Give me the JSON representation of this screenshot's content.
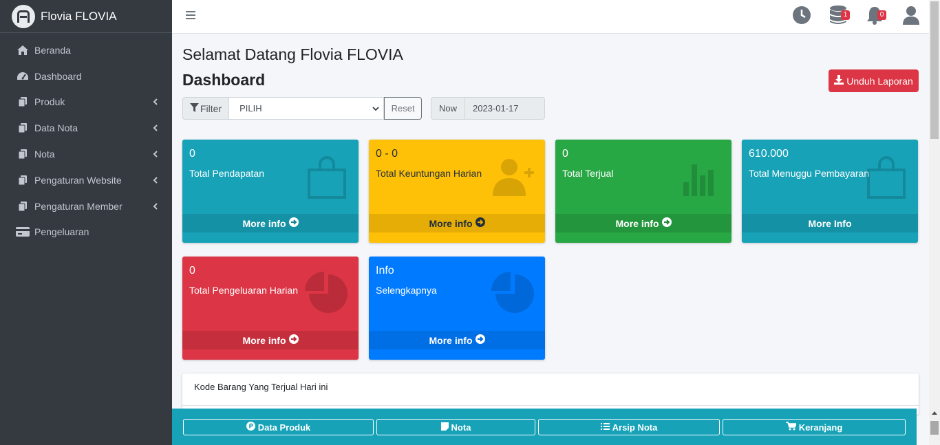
{
  "brand": {
    "name": "Flovia FLOVIA"
  },
  "sidebar": {
    "items": [
      {
        "label": "Beranda",
        "icon": "home-icon",
        "has_children": false
      },
      {
        "label": "Dashboard",
        "icon": "tachometer-icon",
        "has_children": false
      },
      {
        "label": "Produk",
        "icon": "copy-icon",
        "has_children": true
      },
      {
        "label": "Data Nota",
        "icon": "copy-icon",
        "has_children": true
      },
      {
        "label": "Nota",
        "icon": "copy-icon",
        "has_children": true
      },
      {
        "label": "Pengaturan Website",
        "icon": "copy-icon",
        "has_children": true
      },
      {
        "label": "Pengaturan Member",
        "icon": "copy-icon",
        "has_children": true
      },
      {
        "label": "Pengeluaran",
        "icon": "credit-card-icon",
        "has_children": false
      }
    ]
  },
  "navbar": {
    "icons": [
      {
        "name": "clock-icon",
        "badge": null
      },
      {
        "name": "database-icon",
        "badge": "1"
      },
      {
        "name": "bell-icon",
        "badge": "0"
      },
      {
        "name": "user-icon",
        "badge": null
      }
    ]
  },
  "header": {
    "greeting": "Selamat Datang Flovia FLOVIA",
    "title": "Dashboard",
    "download_label": "Unduh Laporan"
  },
  "filter": {
    "label": "Filter",
    "selected": "PILIH",
    "reset_label": "Reset",
    "now_label": "Now",
    "now_value": "2023-01-17"
  },
  "boxes": [
    {
      "value": "0",
      "label": "Total Pendapatan",
      "footer": "More info",
      "color": "#17a2b8",
      "icon": "shopping-bag-icon"
    },
    {
      "value": "0 - 0",
      "label": "Total Keuntungan Harian",
      "footer": "More info",
      "color": "#ffc107",
      "icon": "user-plus-icon"
    },
    {
      "value": "0",
      "label": "Total Terjual",
      "footer": "More info",
      "color": "#28a745",
      "icon": "bar-chart-icon"
    },
    {
      "value": "610.000",
      "label": "Total Menuggu Pembayaran",
      "footer": "More Info",
      "color": "#17a2b8",
      "icon": "shopping-bag-icon"
    },
    {
      "value": "0",
      "label": "Total Pengeluaran Harian",
      "footer": "More info",
      "color": "#dc3545",
      "icon": "pie-chart-icon"
    },
    {
      "value": "Info",
      "label": "Selengkapnya",
      "footer": "More info",
      "color": "#007bff",
      "icon": "pie-chart-icon"
    }
  ],
  "card": {
    "title": "Kode Barang Yang Terjual Hari ini"
  },
  "bottom_bar": {
    "buttons": [
      {
        "label": "Data Produk",
        "icon": "product-hunt-icon"
      },
      {
        "label": "Nota",
        "icon": "sticky-note-icon"
      },
      {
        "label": "Arsip Nota",
        "icon": "list-icon"
      },
      {
        "label": "Keranjang",
        "icon": "cart-icon"
      }
    ]
  }
}
